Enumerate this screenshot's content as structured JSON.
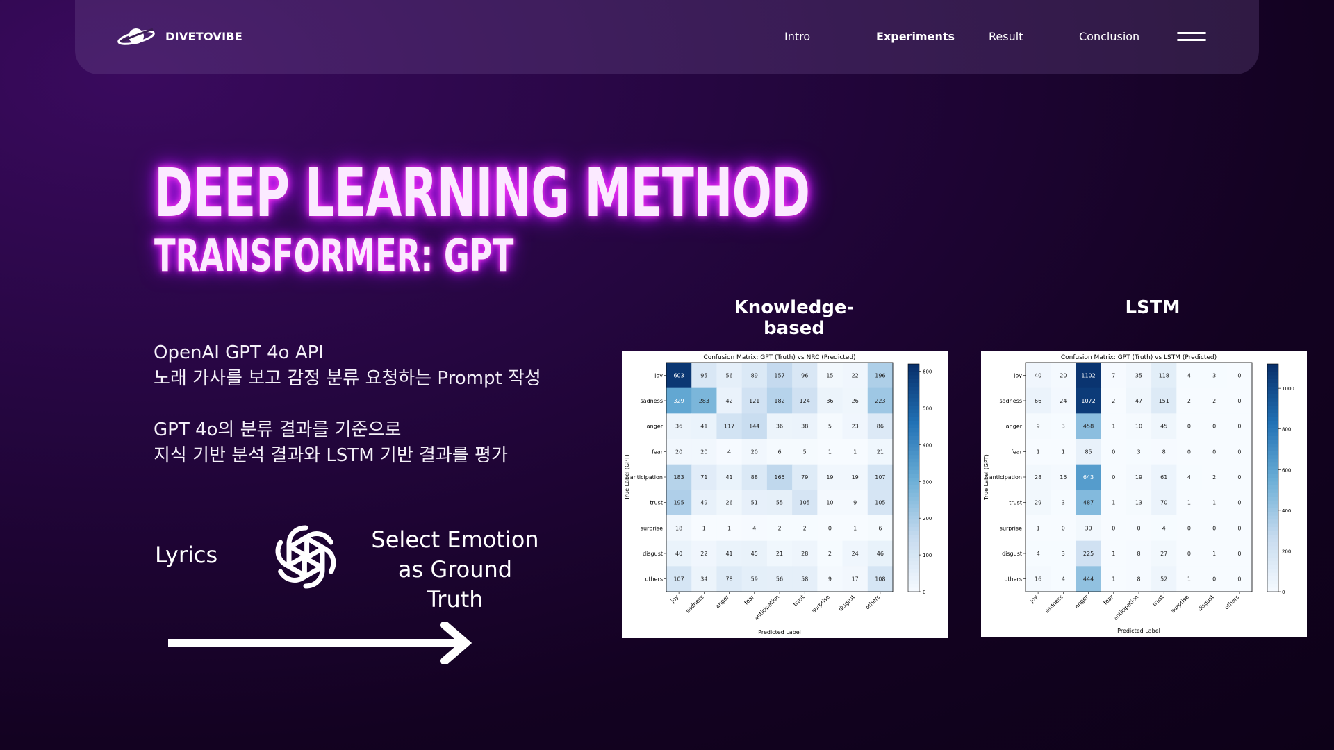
{
  "nav": {
    "brand": "DIVETOVIBE",
    "links": [
      "Intro",
      "Experiments",
      "Result",
      "Conclusion"
    ],
    "active": "Experiments"
  },
  "hero": {
    "title": "DEEP LEARNING METHOD",
    "subtitle": "TRANSFORMER: GPT"
  },
  "description": {
    "line1": "OpenAI GPT 4o API",
    "line2": "노래 가사를 보고 감정 분류 요청하는 Prompt 작성",
    "line3": "GPT 4o의 분류 결과를 기준으로",
    "line4": "지식 기반 분석 결과와 LSTM 기반 결과를 평가"
  },
  "flow": {
    "input": "Lyrics",
    "output_line1": "Select Emotion",
    "output_line2": "as Ground Truth",
    "logo_icon": "openai-logo-icon"
  },
  "panels": {
    "left_title": "Knowledge-based",
    "right_title": "LSTM"
  },
  "chart_data": [
    {
      "type": "heatmap",
      "title": "Confusion Matrix: GPT (Truth) vs NRC (Predicted)",
      "xlabel": "Predicted Label",
      "ylabel": "True Label (GPT)",
      "labels": [
        "joy",
        "sadness",
        "anger",
        "fear",
        "anticipation",
        "trust",
        "surprise",
        "disgust",
        "others"
      ],
      "matrix": [
        [
          603,
          95,
          56,
          89,
          157,
          96,
          15,
          22,
          196
        ],
        [
          329,
          283,
          42,
          121,
          182,
          124,
          36,
          26,
          223
        ],
        [
          36,
          41,
          117,
          144,
          36,
          38,
          5,
          23,
          86
        ],
        [
          20,
          20,
          4,
          20,
          6,
          5,
          1,
          1,
          21
        ],
        [
          183,
          71,
          41,
          88,
          165,
          79,
          19,
          19,
          107
        ],
        [
          195,
          49,
          26,
          51,
          55,
          105,
          10,
          9,
          105
        ],
        [
          18,
          1,
          1,
          4,
          2,
          2,
          0,
          1,
          6
        ],
        [
          40,
          22,
          41,
          45,
          21,
          28,
          2,
          24,
          46
        ],
        [
          107,
          34,
          78,
          59,
          56,
          58,
          9,
          17,
          108
        ]
      ],
      "colorbar_ticks": [
        0,
        100,
        200,
        300,
        400,
        500,
        600
      ],
      "vmax": 620
    },
    {
      "type": "heatmap",
      "title": "Confusion Matrix: GPT (Truth) vs LSTM (Predicted)",
      "xlabel": "Predicted Label",
      "ylabel": "True Label (GPT)",
      "labels": [
        "joy",
        "sadness",
        "anger",
        "fear",
        "anticipation",
        "trust",
        "surprise",
        "disgust",
        "others"
      ],
      "matrix": [
        [
          40,
          20,
          1102,
          7,
          35,
          118,
          4,
          3,
          0
        ],
        [
          66,
          24,
          1072,
          2,
          47,
          151,
          2,
          2,
          0
        ],
        [
          9,
          3,
          458,
          1,
          10,
          45,
          0,
          0,
          0
        ],
        [
          1,
          1,
          85,
          0,
          3,
          8,
          0,
          0,
          0
        ],
        [
          28,
          15,
          643,
          0,
          19,
          61,
          4,
          2,
          0
        ],
        [
          29,
          3,
          487,
          1,
          13,
          70,
          1,
          1,
          0
        ],
        [
          1,
          0,
          30,
          0,
          0,
          4,
          0,
          0,
          0
        ],
        [
          4,
          3,
          225,
          1,
          8,
          27,
          0,
          1,
          0
        ],
        [
          16,
          4,
          444,
          1,
          8,
          52,
          1,
          0,
          0
        ]
      ],
      "colorbar_ticks": [
        0,
        200,
        400,
        600,
        800,
        1000
      ],
      "vmax": 1120
    }
  ],
  "colors": {
    "glow": "#d21cff",
    "heat_low": "#f7fbff",
    "heat_high": "#08306b"
  }
}
